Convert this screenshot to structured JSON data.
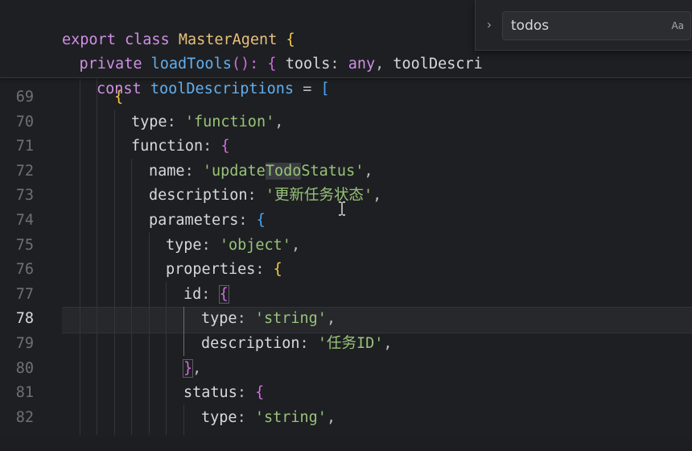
{
  "search": {
    "query": "todos",
    "match_case_label": "Aa"
  },
  "sticky": [
    [
      "export",
      "class",
      "MasterAgent",
      "{"
    ],
    [
      "private",
      "loadTools",
      "()",
      ": {",
      "tools",
      ":",
      "any",
      ",",
      "toolDescri"
    ],
    [
      "const",
      "toolDescriptions",
      "=",
      "["
    ]
  ],
  "lines": [
    {
      "n": "69",
      "parts": [
        "{"
      ]
    },
    {
      "n": "70",
      "parts": [
        "type",
        ": ",
        "'function'",
        ","
      ]
    },
    {
      "n": "71",
      "parts": [
        "function",
        ": ",
        "{"
      ]
    },
    {
      "n": "72",
      "parts": [
        "name",
        ": ",
        "'update",
        "Todo",
        "Status'",
        ","
      ]
    },
    {
      "n": "73",
      "parts": [
        "description",
        ": ",
        "'更新任务状态'",
        ","
      ]
    },
    {
      "n": "74",
      "parts": [
        "parameters",
        ": ",
        "{"
      ]
    },
    {
      "n": "75",
      "parts": [
        "type",
        ": ",
        "'object'",
        ","
      ]
    },
    {
      "n": "76",
      "parts": [
        "properties",
        ": ",
        "{"
      ]
    },
    {
      "n": "77",
      "parts": [
        "id",
        ": ",
        "{"
      ]
    },
    {
      "n": "78",
      "parts": [
        "type",
        ": ",
        "'string'",
        ","
      ]
    },
    {
      "n": "79",
      "parts": [
        "description",
        ": ",
        "'任务ID'",
        ","
      ]
    },
    {
      "n": "80",
      "parts": [
        "}",
        ","
      ]
    },
    {
      "n": "81",
      "parts": [
        "status",
        ": ",
        "{"
      ]
    },
    {
      "n": "82",
      "parts": [
        "type",
        ": ",
        "'string'",
        ","
      ]
    }
  ],
  "active_line": "78",
  "colors": {
    "keyword": "#cf8fe6",
    "function": "#61afef",
    "string": "#98c379",
    "brace_level1": "#f2c94c",
    "brace_level2": "#cf6ddd",
    "brace_level3": "#4ba3f5"
  }
}
